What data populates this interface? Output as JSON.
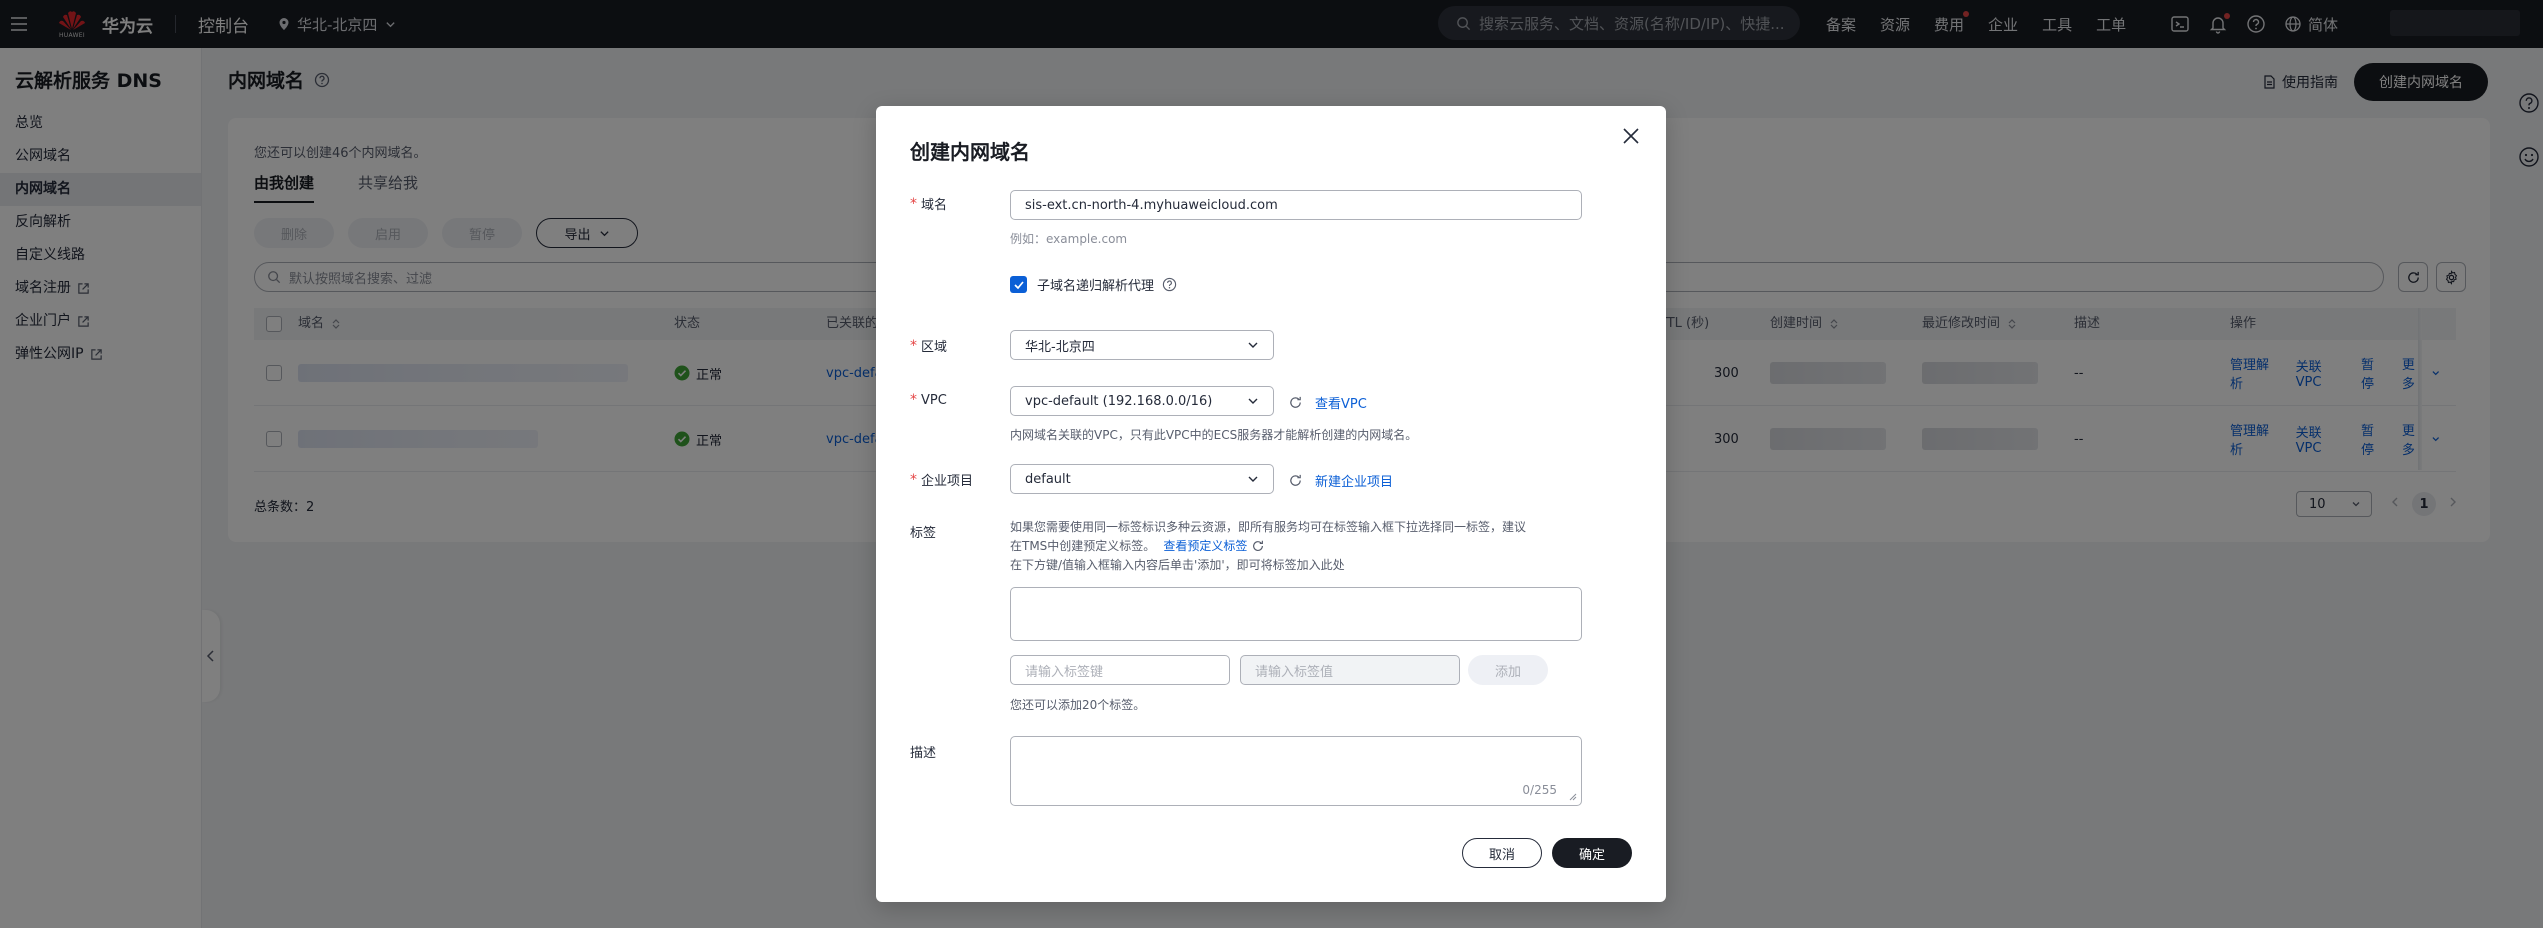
{
  "topbar": {
    "logo_text": "HUAWEI",
    "brand": "华为云",
    "console": "控制台",
    "region": "华北-北京四",
    "search_placeholder": "搜索云服务、文档、资源(名称/ID/IP)、快捷...",
    "links": [
      "备案",
      "资源",
      "费用",
      "企业",
      "工具",
      "工单"
    ],
    "language": "简体"
  },
  "sidebar": {
    "service_title": "云解析服务 DNS",
    "items": [
      {
        "label": "总览",
        "external": false
      },
      {
        "label": "公网域名",
        "external": false
      },
      {
        "label": "内网域名",
        "external": false,
        "active": true
      },
      {
        "label": "反向解析",
        "external": false
      },
      {
        "label": "自定义线路",
        "external": false
      },
      {
        "label": "域名注册",
        "external": true
      },
      {
        "label": "企业门户",
        "external": true
      },
      {
        "label": "弹性公网IP",
        "external": true
      }
    ]
  },
  "page": {
    "title": "内网域名",
    "guide": "使用指南",
    "create_button": "创建内网域名",
    "quota_text": "您还可以创建46个内网域名。",
    "tabs": [
      "由我创建",
      "共享给我"
    ],
    "actions": {
      "delete": "删除",
      "enable": "启用",
      "pause": "暂停",
      "export": "导出"
    },
    "search_placeholder": "默认按照域名搜索、过滤",
    "columns": {
      "name": "域名",
      "status": "状态",
      "vpc": "已关联的",
      "ttl": "TTL (秒)",
      "created": "创建时间",
      "modified": "最近修改时间",
      "desc": "描述",
      "ops": "操作"
    },
    "rows": [
      {
        "status": "正常",
        "vpc": "vpc-defa",
        "ttl": "300",
        "desc": "--",
        "ops": [
          "管理解析",
          "关联VPC",
          "暂停",
          "更多"
        ]
      },
      {
        "status": "正常",
        "vpc": "vpc-defa",
        "ttl": "300",
        "desc": "--",
        "ops": [
          "管理解析",
          "关联VPC",
          "暂停",
          "更多"
        ]
      }
    ],
    "total": "总条数：2",
    "page_size": "10",
    "current_page": "1"
  },
  "modal": {
    "title": "创建内网域名",
    "domain_label": "域名",
    "domain_value": "sis-ext.cn-north-4.myhuaweicloud.com",
    "domain_hint": "例如：example.com",
    "recursive_label": "子域名递归解析代理",
    "region_label": "区域",
    "region_value": "华北-北京四",
    "vpc_label": "VPC",
    "vpc_value": "vpc-default (192.168.0.0/16)",
    "vpc_link": "查看VPC",
    "vpc_hint": "内网域名关联的VPC，只有此VPC中的ECS服务器才能解析创建的内网域名。",
    "project_label": "企业项目",
    "project_value": "default",
    "project_link": "新建企业项目",
    "tag_label": "标签",
    "tag_hint_line1": "如果您需要使用同一标签标识多种云资源，即所有服务均可在标签输入框下拉选择同一标签，建议",
    "tag_hint_line2": "在TMS中创建预定义标签。",
    "tag_hint_link": "查看预定义标签",
    "tag_hint_line3": "在下方键/值输入框输入内容后单击'添加'，即可将标签加入此处",
    "tag_key_placeholder": "请输入标签键",
    "tag_value_placeholder": "请输入标签值",
    "tag_add": "添加",
    "tag_quota": "您还可以添加20个标签。",
    "desc_label": "描述",
    "desc_count": "0/255",
    "cancel": "取消",
    "confirm": "确定"
  }
}
